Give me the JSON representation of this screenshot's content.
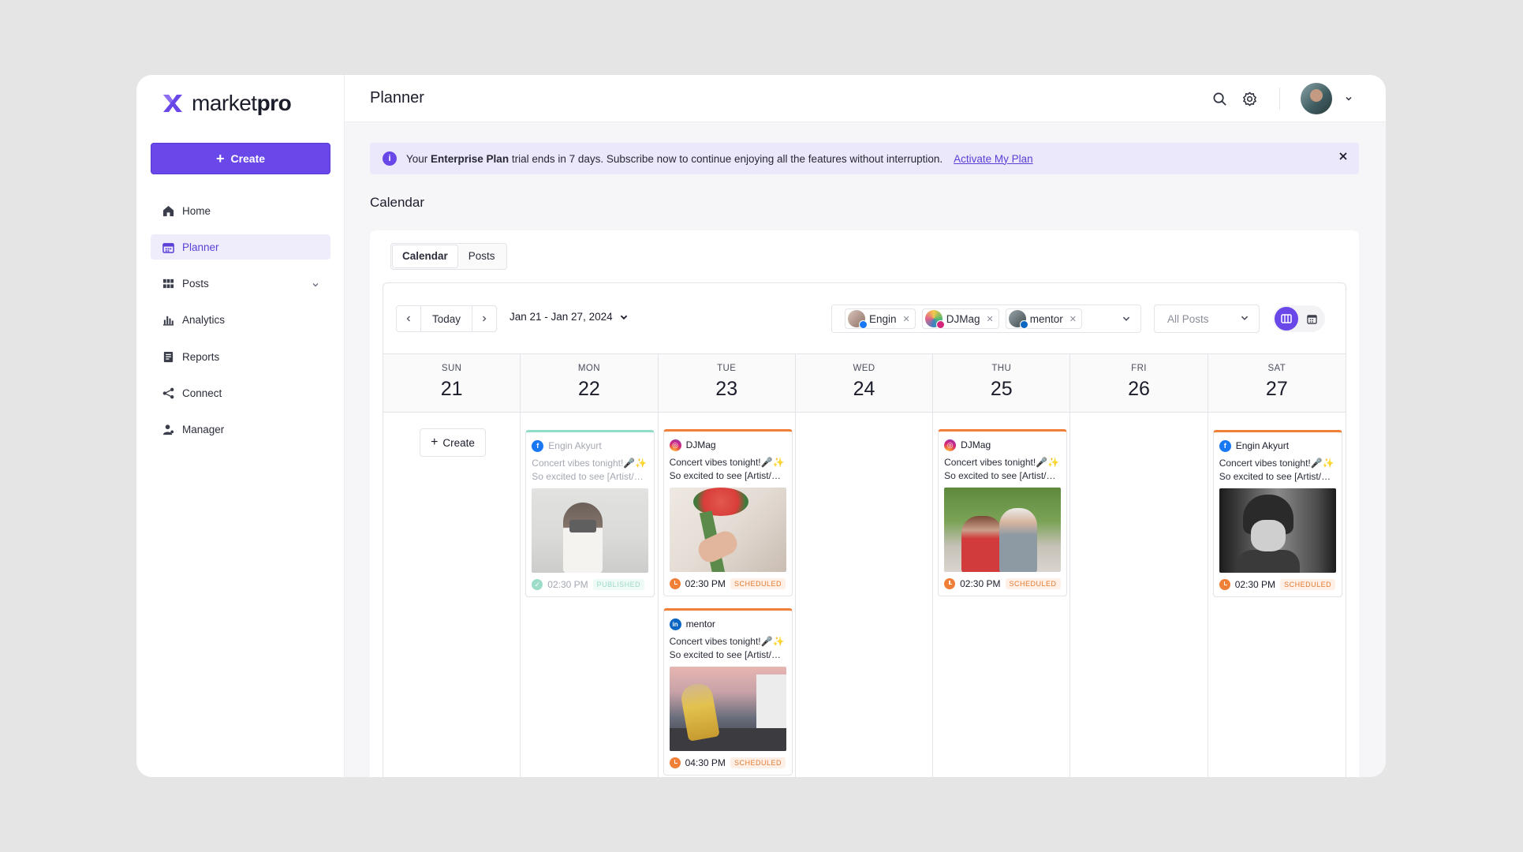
{
  "app": {
    "logo_text_light": "market",
    "logo_text_bold": "pro",
    "brand_color": "#6a47e8"
  },
  "sidebar": {
    "create_label": "Create",
    "items": [
      {
        "label": "Home",
        "icon": "home-icon"
      },
      {
        "label": "Planner",
        "icon": "calendar-icon",
        "active": true
      },
      {
        "label": "Posts",
        "icon": "grid-icon",
        "expandable": true
      },
      {
        "label": "Analytics",
        "icon": "bar-chart-icon"
      },
      {
        "label": "Reports",
        "icon": "report-icon"
      },
      {
        "label": "Connect",
        "icon": "share-icon"
      },
      {
        "label": "Manager",
        "icon": "users-icon"
      }
    ]
  },
  "header": {
    "title": "Planner"
  },
  "banner": {
    "text_before": "Your ",
    "text_bold": "Enterprise Plan",
    "text_after": " trial ends in 7 days. Subscribe now to continue enjoying all the features without interruption.",
    "link": "Activate My Plan"
  },
  "section": {
    "title": "Calendar"
  },
  "tabs": [
    {
      "label": "Calendar",
      "active": true
    },
    {
      "label": "Posts",
      "active": false
    }
  ],
  "calendar": {
    "today_label": "Today",
    "date_range": "Jan 21 - Jan 27, 2024",
    "accounts": [
      {
        "name": "Engin",
        "network": "facebook"
      },
      {
        "name": "DJMag",
        "network": "instagram"
      },
      {
        "name": "mentor",
        "network": "linkedin"
      }
    ],
    "post_filter": "All Posts",
    "create_label": "Create",
    "days": [
      {
        "dow": "SUN",
        "num": "21"
      },
      {
        "dow": "MON",
        "num": "22"
      },
      {
        "dow": "TUE",
        "num": "23"
      },
      {
        "dow": "WED",
        "num": "24"
      },
      {
        "dow": "THU",
        "num": "25"
      },
      {
        "dow": "FRI",
        "num": "26"
      },
      {
        "dow": "SAT",
        "num": "27"
      }
    ],
    "posts": {
      "mon": {
        "account": "Engin Akyurt",
        "caption1": "Concert vibes tonight!🎤✨",
        "caption2": "So excited to see [Artist/Band]!",
        "time": "02:30 PM",
        "status": "PUBLISHED"
      },
      "tue1": {
        "account": "DJMag",
        "caption1": "Concert vibes tonight!🎤✨",
        "caption2": "So excited to see [Artist/Band]!",
        "time": "02:30 PM",
        "status": "SCHEDULED"
      },
      "tue2": {
        "account": "mentor",
        "caption1": "Concert vibes tonight!🎤✨",
        "caption2": "So excited to see [Artist/Band]!",
        "time": "04:30 PM",
        "status": "SCHEDULED"
      },
      "thu": {
        "account": "DJMag",
        "caption1": "Concert vibes tonight!🎤✨",
        "caption2": "So excited to see [Artist/Band]!",
        "time": "02:30 PM",
        "status": "SCHEDULED"
      },
      "sat": {
        "account": "Engin Akyurt",
        "caption1": "Concert vibes tonight!🎤✨",
        "caption2": "So excited to see [Artist/Band]!",
        "time": "02:30 PM",
        "status": "SCHEDULED"
      }
    }
  }
}
